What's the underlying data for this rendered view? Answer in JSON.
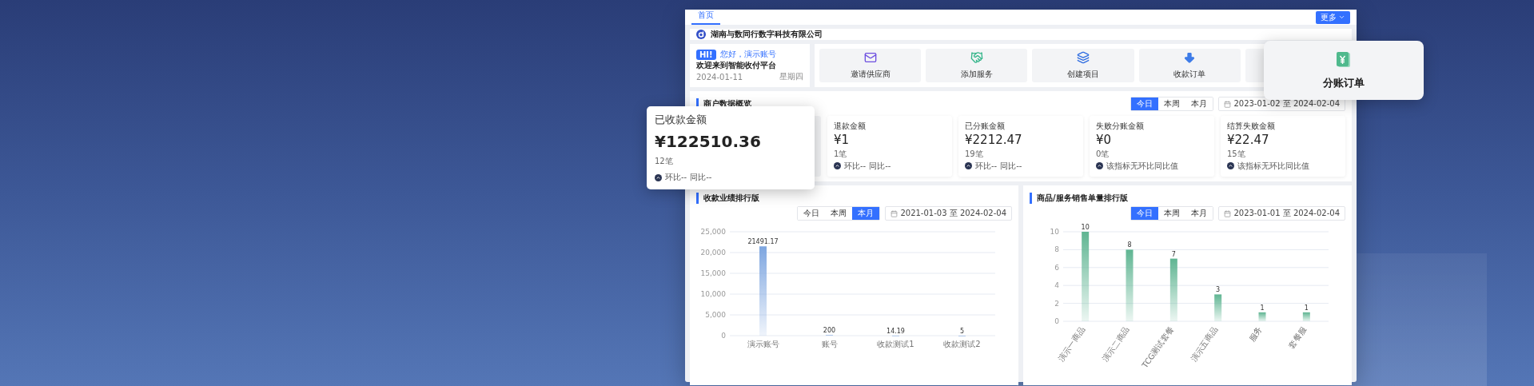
{
  "tabs": [
    {
      "label": "首页",
      "selected": true
    }
  ],
  "more_button": {
    "label": "更多"
  },
  "company": {
    "name": "湖南与数同行数字科技有限公司"
  },
  "welcome": {
    "badge": "HI!",
    "greeting": "您好，演示账号",
    "subtitle": "欢迎来到智能收付平台",
    "date": "2024-01-11",
    "weekday": "星期四"
  },
  "quick_actions": [
    {
      "label": "邀请供应商",
      "raised": false
    },
    {
      "label": "添加服务",
      "raised": false
    },
    {
      "label": "创建项目",
      "raised": false
    },
    {
      "label": "收款订单",
      "raised": false
    },
    {
      "label": "分账订单",
      "raised": true
    }
  ],
  "overview": {
    "title": "商户数据概览",
    "periods": [
      {
        "label": "今日",
        "selected": true
      },
      {
        "label": "本周",
        "selected": false
      },
      {
        "label": "本月",
        "selected": false
      }
    ],
    "date_range": "2023-01-02 至 2024-02-04",
    "cards": [
      {
        "title": "已收款金额",
        "amount": "¥122510.36",
        "count": "12笔",
        "note": "环比--",
        "note_2": "同比--",
        "raised": true
      },
      {
        "title": "退款金额",
        "amount": "¥1",
        "count": "1笔",
        "note": "环比--",
        "note_2": "同比--",
        "raised": false
      },
      {
        "title": "已分账金额",
        "amount": "¥2212.47",
        "count": "19笔",
        "note": "环比--",
        "note_2": "同比--",
        "raised": false
      },
      {
        "title": "失败分账金额",
        "amount": "¥0",
        "count": "0笔",
        "note": "该指标无环比同比值",
        "raised": false
      },
      {
        "title": "结算失败金额",
        "amount": "¥22.47",
        "count": "15笔",
        "note": "该指标无环比同比值",
        "raised": false
      }
    ]
  },
  "charts": [
    {
      "title": "收款业绩排行版",
      "periods": [
        {
          "label": "今日",
          "selected": false
        },
        {
          "label": "本周",
          "selected": false
        },
        {
          "label": "本月",
          "selected": true
        }
      ],
      "date_range": "2021-01-03 至 2024-02-04",
      "chart_data": {
        "type": "bar",
        "categories": [
          "演示账号",
          "账号",
          "收款测试1",
          "收款测试2"
        ],
        "series": [
          {
            "color": "#7ea6e0",
            "values": [
              21491,
              200,
              14,
              5
            ]
          }
        ],
        "grid": true,
        "value_labels": [
          "21491.17",
          "200",
          "14.19",
          "5"
        ],
        "ylim": [
          0,
          25000
        ],
        "yticks": [
          {
            "value": 0,
            "label": "0"
          },
          {
            "value": 5000,
            "label": "5,000"
          },
          {
            "value": 10000,
            "label": "10,000"
          },
          {
            "value": 15000,
            "label": "15,000"
          },
          {
            "value": 20000,
            "label": "20,000"
          },
          {
            "value": 25000,
            "label": "25,000"
          }
        ]
      }
    },
    {
      "title": "商品/服务销售单量排行版",
      "periods": [
        {
          "label": "今日",
          "selected": true
        },
        {
          "label": "本周",
          "selected": false
        },
        {
          "label": "本月",
          "selected": false
        }
      ],
      "date_range": "2023-01-01 至 2024-02-04",
      "chart_data": {
        "type": "bar",
        "categories": [
          "演示一商品",
          "演示二商品",
          "TCG测试套餐",
          "演示五商品",
          "服务",
          "套餐服"
        ],
        "series": [
          {
            "color": "#5fb592",
            "values": [
              10,
              8,
              7,
              3,
              1,
              1
            ]
          }
        ],
        "grid": true,
        "value_labels": [
          "10",
          "8",
          "7",
          "3",
          "1",
          "1"
        ],
        "ylim": [
          0,
          10
        ],
        "yticks": [
          0,
          2,
          4,
          6,
          8,
          10
        ]
      }
    }
  ]
}
